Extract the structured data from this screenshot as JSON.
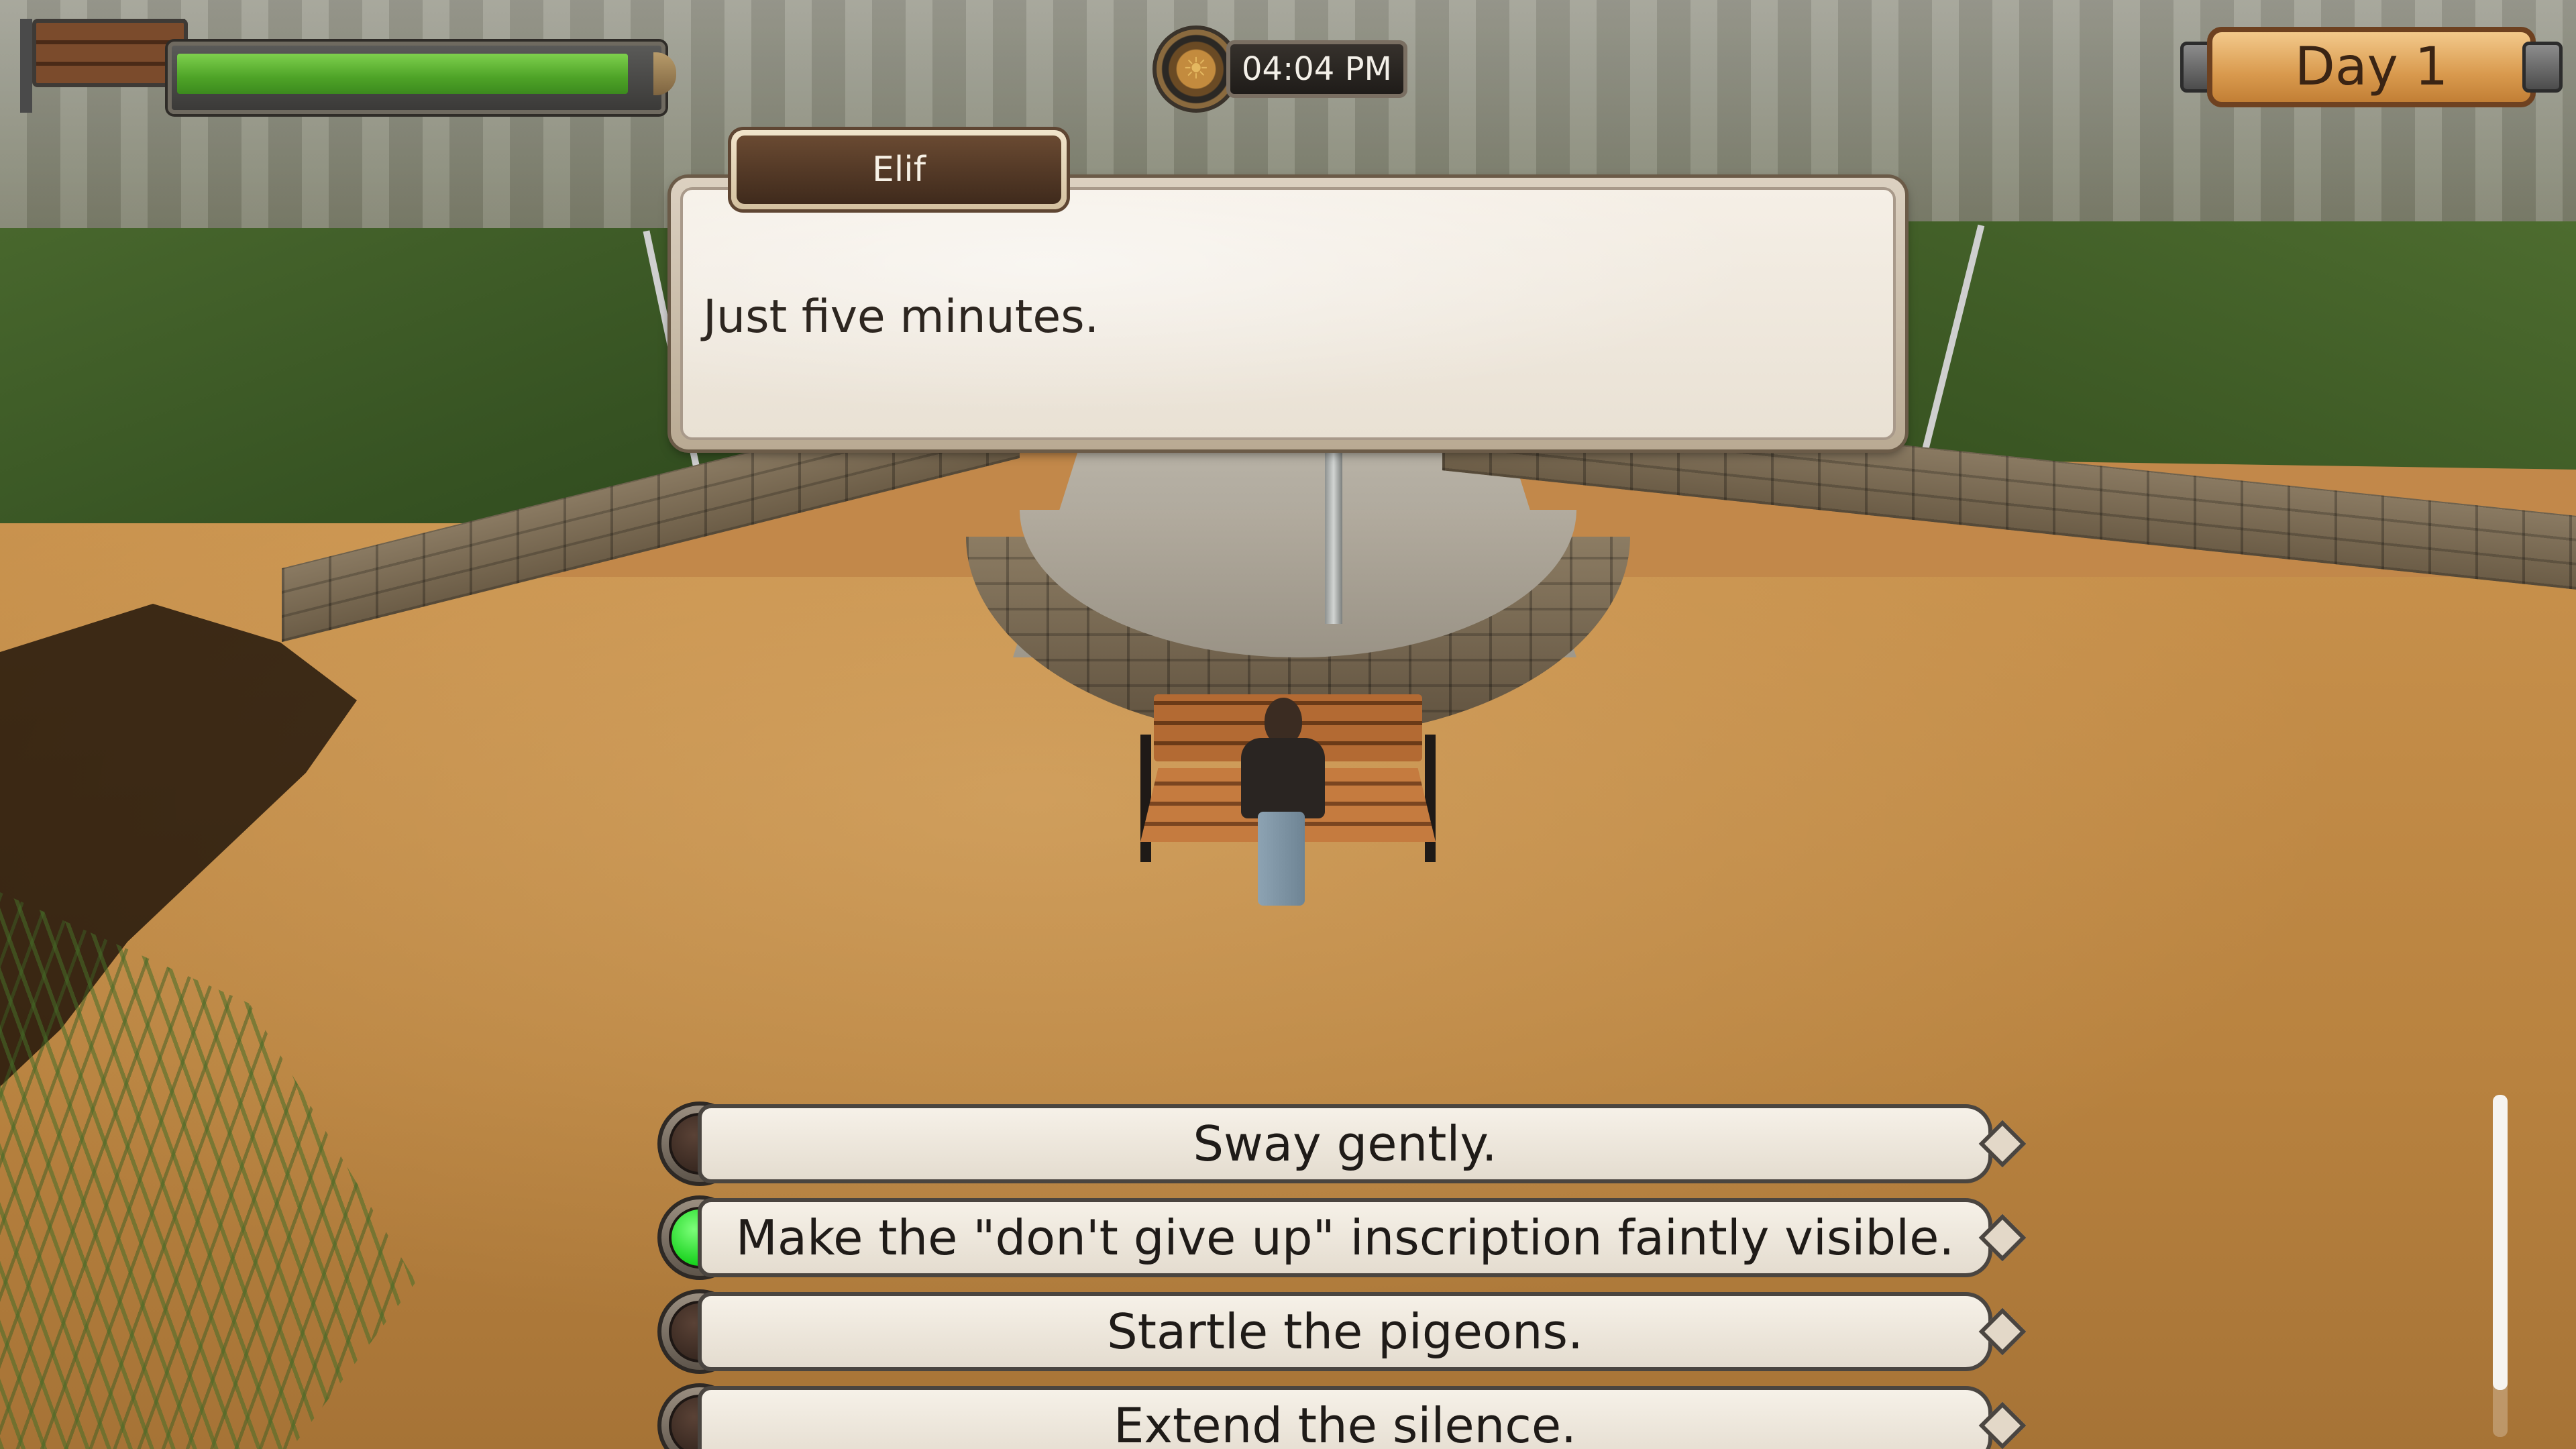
{
  "hud": {
    "meter_level": 0.92,
    "time": "04:04 PM",
    "day": "Day 1"
  },
  "dialogue": {
    "speaker": "Elif",
    "text": "Just five minutes."
  },
  "choices": [
    {
      "label": "Sway gently.",
      "selected": false
    },
    {
      "label": "Make the \"don't give up\" inscription faintly visible.",
      "selected": true
    },
    {
      "label": "Startle the pigeons.",
      "selected": false
    },
    {
      "label": "Extend the silence.",
      "selected": false
    }
  ],
  "colors": {
    "selected_indicator": "#18d21e",
    "meter_fill": "#4ea327"
  }
}
